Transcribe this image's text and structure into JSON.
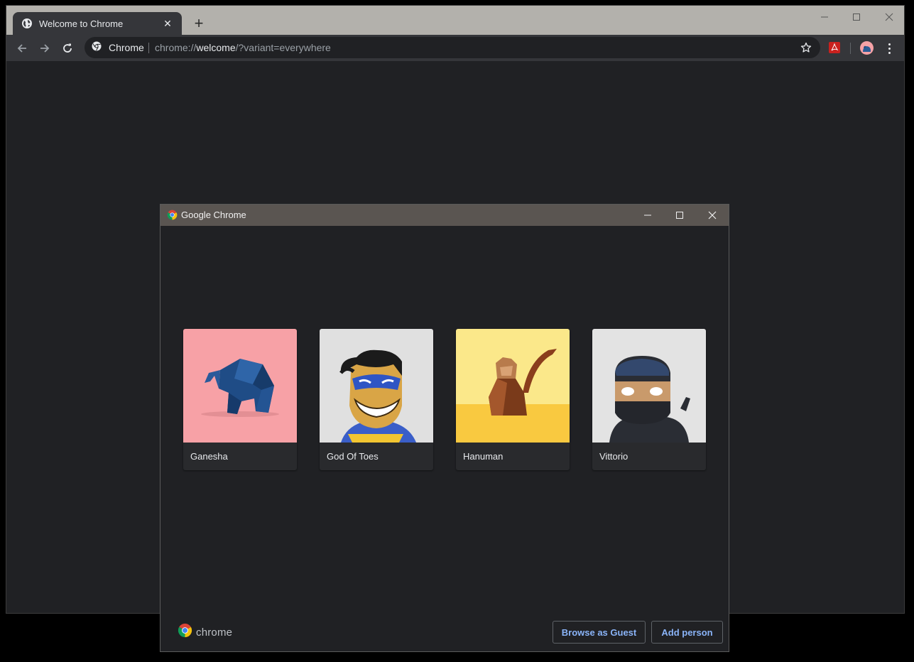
{
  "browser": {
    "tab": {
      "title": "Welcome to Chrome",
      "favicon": "globe-icon"
    },
    "omnibox": {
      "site_label": "Chrome",
      "url_scheme": "chrome://",
      "url_host": "welcome",
      "url_path": "/?variant=everywhere"
    },
    "icons": [
      "back-icon",
      "forward-icon",
      "reload-icon",
      "star-icon",
      "pdf-extension-icon",
      "profile-avatar",
      "menu-icon",
      "new-tab-icon",
      "minimize-icon",
      "maximize-icon",
      "close-icon"
    ]
  },
  "dialog": {
    "title": "Google Chrome",
    "profiles": [
      {
        "name": "Ganesha",
        "bg": "#f7a1a6"
      },
      {
        "name": "God Of Toes",
        "bg": "#e0e0e0"
      },
      {
        "name": "Hanuman",
        "bg": "#fbe88a"
      },
      {
        "name": "Vittorio",
        "bg": "#e3e3e3"
      }
    ],
    "footer_brand": "chrome",
    "buttons": {
      "guest": "Browse as Guest",
      "add": "Add person"
    }
  },
  "colors": {
    "accent": "#8ab4f8",
    "background": "#202124",
    "toolbar": "#35363a",
    "tabstrip": "#b3b1ac",
    "dialog_titlebar": "#5a5551"
  }
}
